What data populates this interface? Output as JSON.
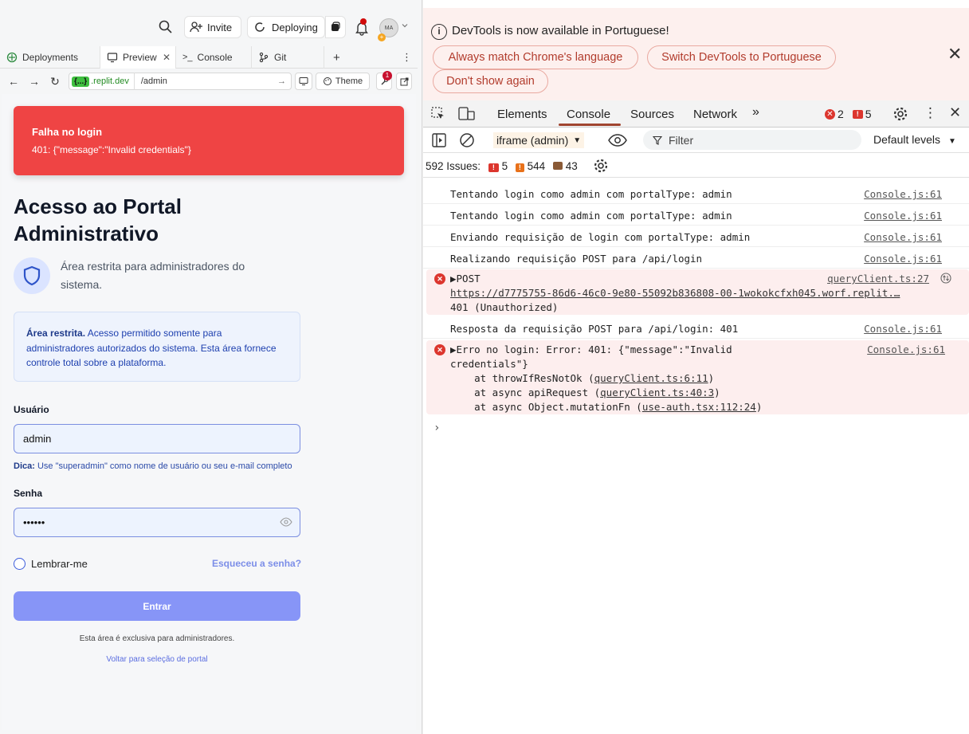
{
  "topbar": {
    "invite_label": "Invite",
    "deploying_label": "Deploying",
    "avatar_initials": "MA"
  },
  "tabs": [
    {
      "label": "Deployments"
    },
    {
      "label": "Preview"
    },
    {
      "label": "Console"
    },
    {
      "label": "Git"
    }
  ],
  "urlbar": {
    "host_badge": "{...}",
    "domain": ".replit.dev",
    "path": "/admin",
    "theme_label": "Theme",
    "badge_count": "1"
  },
  "page": {
    "toast_title": "Falha no login",
    "toast_message": "401: {\"message\":\"Invalid credentials\"}",
    "title": "Acesso ao Portal Administrativo",
    "subtitle": "Área restrita para administradores do sistema.",
    "info_bold": "Área restrita.",
    "info_text": " Acesso permitido somente para administradores autorizados do sistema. Esta área fornece controle total sobre a plataforma.",
    "username_label": "Usuário",
    "username_value": "admin",
    "hint_bold": "Dica:",
    "hint_text": " Use \"superadmin\" como nome de usuário ou seu e-mail completo",
    "password_label": "Senha",
    "password_value": "••••••",
    "remember_label": "Lembrar-me",
    "forgot_label": "Esqueceu a senha?",
    "submit_label": "Entrar",
    "footer_text": "Esta área é exclusiva para administradores.",
    "back_link": "Voltar para seleção de portal"
  },
  "devtools": {
    "notice": "DevTools is now available in Portuguese!",
    "btn_match": "Always match Chrome's language",
    "btn_switch": "Switch DevTools to Portuguese",
    "btn_dont": "Don't show again",
    "tabs": [
      "Elements",
      "Console",
      "Sources",
      "Network"
    ],
    "error_count": "2",
    "warn_count": "5",
    "context": "iframe (admin)",
    "filter_placeholder": "Filter",
    "levels": "Default levels",
    "issues_label": "592 Issues:",
    "issues_errors": "5",
    "issues_warnings": "544",
    "issues_info": "43",
    "logs": [
      {
        "text": "Tentando login como admin com portalType: admin",
        "src": "Console.js:61"
      },
      {
        "text": "Tentando login como admin com portalType: admin",
        "src": "Console.js:61"
      },
      {
        "text": "Enviando requisição de login com portalType: admin",
        "src": "Console.js:61"
      },
      {
        "text": "Realizando requisição POST para /api/login",
        "src": "Console.js:61"
      }
    ],
    "err1_line1": "▶POST",
    "err1_src": "queryClient.ts:27",
    "err1_url": "https://d7775755-86d6-46c0-9e80-55092b836808-00-1wokokcfxh045.worf.replit.…",
    "err1_status": "401 (Unauthorized)",
    "log5_text": "Resposta da requisição POST para /api/login: 401",
    "log5_src": "Console.js:61",
    "err2_line1": "▶Erro no login: Error: 401: {\"message\":\"Invalid",
    "err2_line2": "credentials\"}",
    "err2_src": "Console.js:61",
    "stack1_pre": "    at throwIfResNotOk (",
    "stack1_link": "queryClient.ts:6:11",
    "stack2_pre": "    at async apiRequest (",
    "stack2_link": "queryClient.ts:40:3",
    "stack3_pre": "    at async Object.mutationFn (",
    "stack3_link": "use-auth.tsx:112:24",
    "prompt": "›"
  },
  "colors": {
    "toast": "#ef4444",
    "submit": "#8795f7",
    "console_accent": "#a0442f",
    "error_red": "#dc362e"
  }
}
